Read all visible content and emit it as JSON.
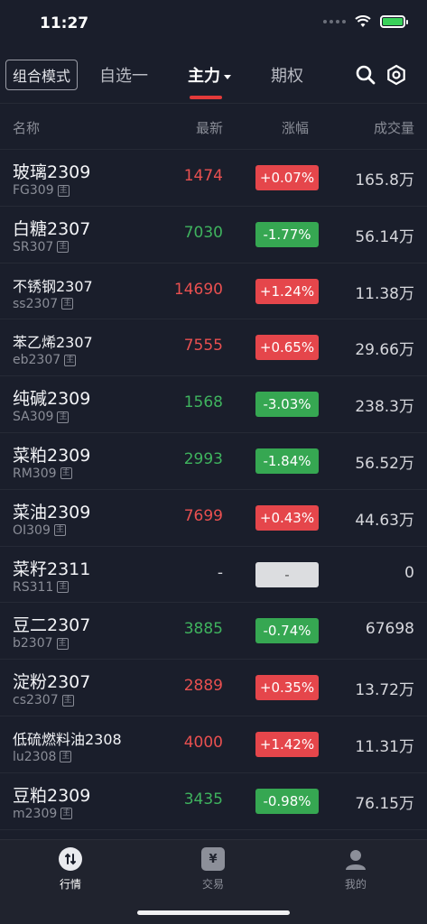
{
  "status_bar": {
    "time": "11:27"
  },
  "header": {
    "mode_button": "组合模式",
    "tabs": [
      {
        "label": "自选一"
      },
      {
        "label": "主力"
      },
      {
        "label": "期权"
      }
    ]
  },
  "columns": {
    "name": "名称",
    "latest": "最新",
    "change": "涨幅",
    "volume": "成交量"
  },
  "code_badge": "主",
  "rows": [
    {
      "name": "玻璃2309",
      "code": "FG309",
      "price": "1474",
      "change": "+0.07%",
      "volume": "165.8万",
      "trend": "up"
    },
    {
      "name": "白糖2307",
      "code": "SR307",
      "price": "7030",
      "change": "-1.77%",
      "volume": "56.14万",
      "trend": "down"
    },
    {
      "name": "不锈钢2307",
      "code": "ss2307",
      "price": "14690",
      "change": "+1.24%",
      "volume": "11.38万",
      "trend": "up"
    },
    {
      "name": "苯乙烯2307",
      "code": "eb2307",
      "price": "7555",
      "change": "+0.65%",
      "volume": "29.66万",
      "trend": "up"
    },
    {
      "name": "纯碱2309",
      "code": "SA309",
      "price": "1568",
      "change": "-3.03%",
      "volume": "238.3万",
      "trend": "down"
    },
    {
      "name": "菜粕2309",
      "code": "RM309",
      "price": "2993",
      "change": "-1.84%",
      "volume": "56.52万",
      "trend": "down"
    },
    {
      "name": "菜油2309",
      "code": "OI309",
      "price": "7699",
      "change": "+0.43%",
      "volume": "44.63万",
      "trend": "up"
    },
    {
      "name": "菜籽2311",
      "code": "RS311",
      "price": "-",
      "change": "-",
      "volume": "0",
      "trend": "flat"
    },
    {
      "name": "豆二2307",
      "code": "b2307",
      "price": "3885",
      "change": "-0.74%",
      "volume": "67698",
      "trend": "down"
    },
    {
      "name": "淀粉2307",
      "code": "cs2307",
      "price": "2889",
      "change": "+0.35%",
      "volume": "13.72万",
      "trend": "up"
    },
    {
      "name": "低硫燃料油2308",
      "code": "lu2308",
      "price": "4000",
      "change": "+1.42%",
      "volume": "11.31万",
      "trend": "up"
    },
    {
      "name": "豆粕2309",
      "code": "m2309",
      "price": "3435",
      "change": "-0.98%",
      "volume": "76.15万",
      "trend": "down"
    }
  ],
  "tabbar": {
    "market": {
      "label": "行情",
      "icon": "market-icon"
    },
    "trade": {
      "label": "交易",
      "icon": "yen-icon",
      "glyph": "¥"
    },
    "mine": {
      "label": "我的",
      "icon": "user-icon"
    }
  },
  "colors": {
    "up": "#e5464b",
    "down": "#36a752",
    "accent": "#e33a3a",
    "background": "#1a1e2b"
  }
}
